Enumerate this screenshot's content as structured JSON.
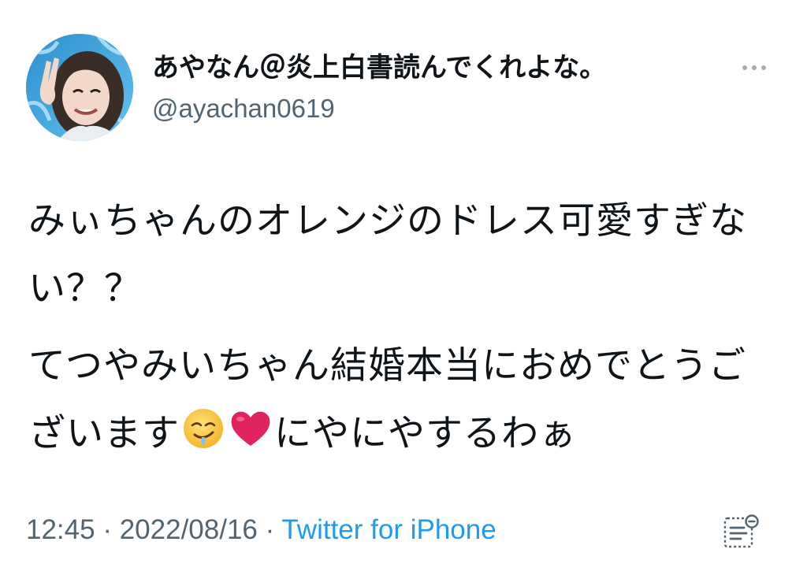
{
  "author": {
    "display_name": "あやなん＠炎上白書読んでくれよな。",
    "handle": "@ayachan0619",
    "avatar_icon": "profile-photo"
  },
  "tweet": {
    "paragraph1": "みぃちゃんのオレンジのドレス可愛すぎない？？",
    "paragraph2_before_emoji": "てつやみいちゃん結婚本当におめでとうございます",
    "emoji1": "drooling-face",
    "emoji2": "red-heart",
    "paragraph2_after_emoji": "にやにやするわぁ"
  },
  "meta": {
    "time": "12:45",
    "separator": " · ",
    "date": "2022/08/16",
    "source": "Twitter for iPhone"
  },
  "icons": {
    "more": "more-horizontal-icon",
    "analytics": "tweet-analytics-icon"
  },
  "colors": {
    "text": "#0f1419",
    "secondary": "#536471",
    "link": "#1d9bf0",
    "heart": "#e0245e"
  }
}
